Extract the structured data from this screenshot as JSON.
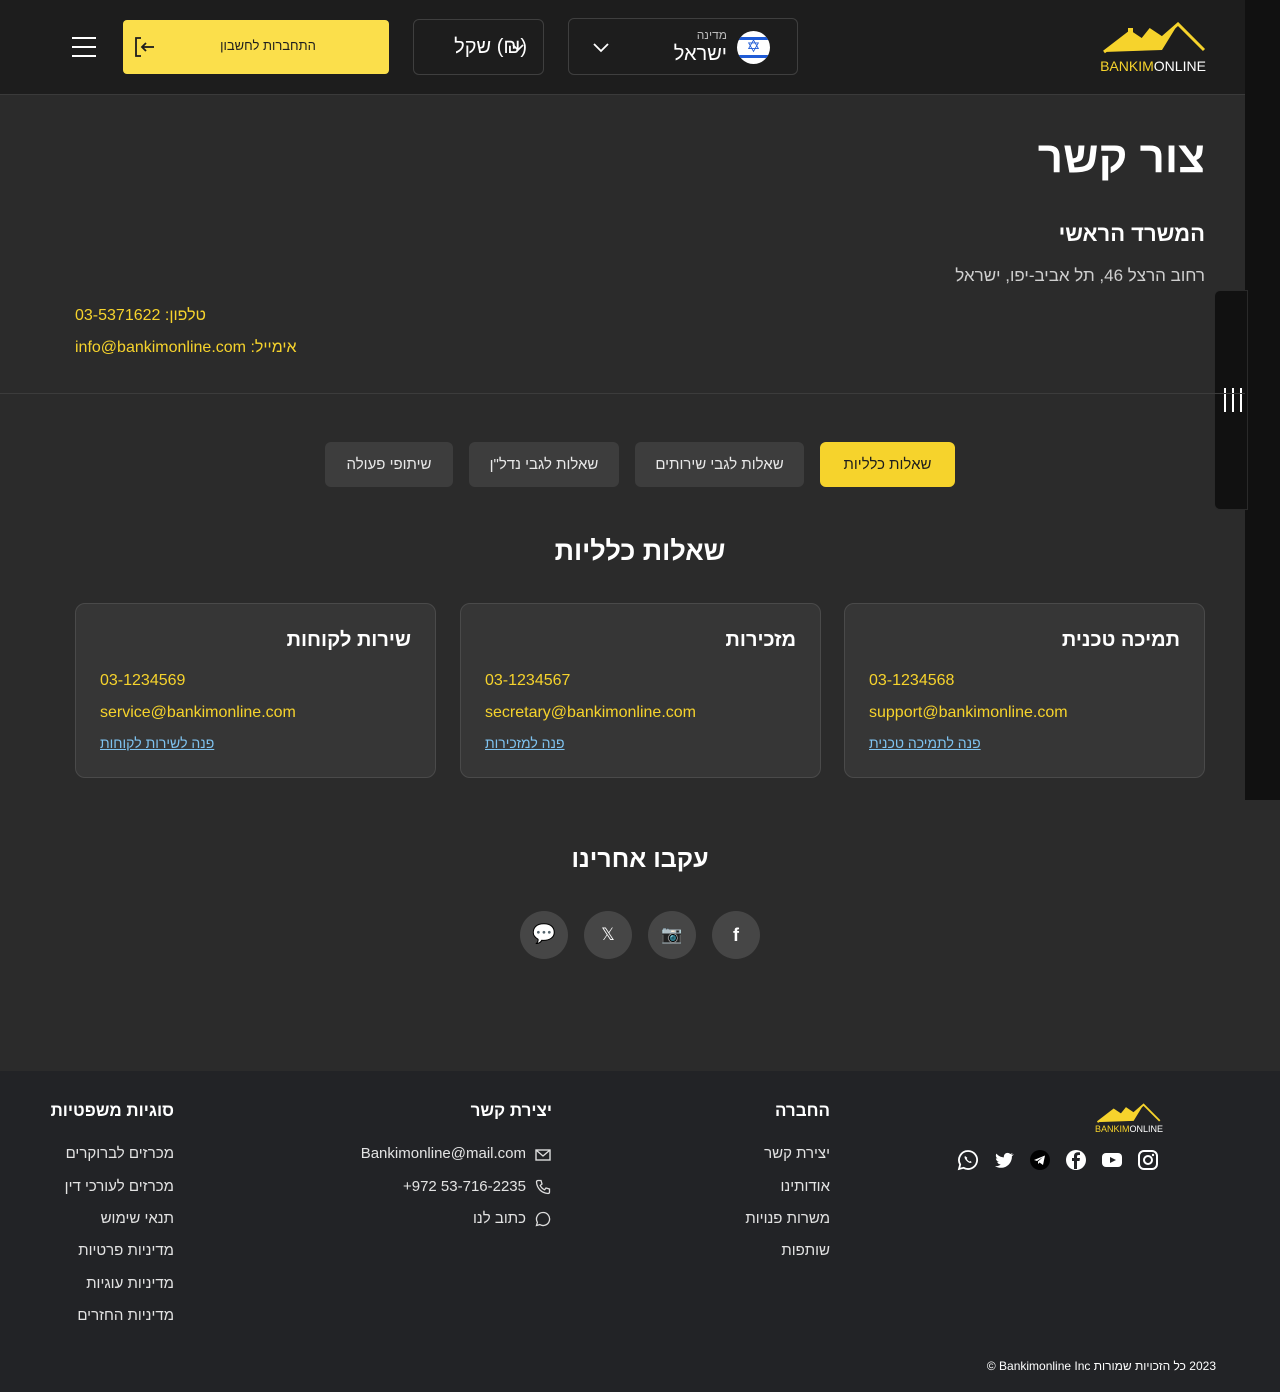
{
  "header": {
    "logo_part1": "BANKIM",
    "logo_part2": "ONLINE",
    "country_label": "מדינה",
    "country_value": "ישראל",
    "currency_value": "שקל (₪)",
    "login_label": "התחברות לחשבון"
  },
  "contact": {
    "title": "צור קשר",
    "office_title": "המשרד הראשי",
    "address": "רחוב הרצל 46, תל אביב-יפו, ישראל",
    "phone_label": "טלפון:",
    "phone": "03-5371622",
    "email_label": "אימייל:",
    "email": "info@bankimonline.com"
  },
  "tabs": [
    {
      "label": "שאלות כלליות",
      "active": true
    },
    {
      "label": "שאלות לגבי שירותים",
      "active": false
    },
    {
      "label": "שאלות לגבי נדל\"ן",
      "active": false
    },
    {
      "label": "שיתופי פעולה",
      "active": false
    }
  ],
  "section_title": "שאלות כלליות",
  "cards": [
    {
      "title": "תמיכה טכנית",
      "phone": "03-1234568",
      "email": "support@bankimonline.com",
      "link": "פנה לתמיכה טכנית"
    },
    {
      "title": "מזכירות",
      "phone": "03-1234567",
      "email": "secretary@bankimonline.com",
      "link": "פנה למזכירות"
    },
    {
      "title": "שירות לקוחות",
      "phone": "03-1234569",
      "email": "service@bankimonline.com",
      "link": "פנה לשירות לקוחות"
    }
  ],
  "follow": {
    "title": "עקבו אחרינו",
    "icons": [
      "facebook-icon",
      "camera-icon",
      "x-icon",
      "chat-icon"
    ],
    "glyphs": [
      "f",
      "📷",
      "𝕏",
      "💬"
    ]
  },
  "footer": {
    "social_icons": [
      "instagram-icon",
      "youtube-icon",
      "facebook-icon",
      "telegram-icon",
      "twitter-icon",
      "whatsapp-icon"
    ],
    "company": {
      "title": "החברה",
      "links": [
        "יצירת קשר",
        "אודותינו",
        "משרות פנויות",
        "שותפות"
      ]
    },
    "contact": {
      "title": "יצירת קשר",
      "email": "Bankimonline@mail.com",
      "phone": "+972 53-716-2235",
      "write": "כתוב לנו"
    },
    "legal": {
      "title": "סוגיות משפטיות",
      "links": [
        "מכרזים לברוקרים",
        "מכרזים לעורכי דין",
        "תנאי שימוש",
        "מדיניות פרטיות",
        "מדיניות עוגיות",
        "מדיניות החזרים"
      ]
    },
    "copyright": "2023 כל הזכויות שמורות Bankimonline Inc ©"
  },
  "colors": {
    "accent": "#f6d32c",
    "link": "#7fc3f0",
    "background": "#2b2b2b",
    "header": "#1d1d1d"
  }
}
